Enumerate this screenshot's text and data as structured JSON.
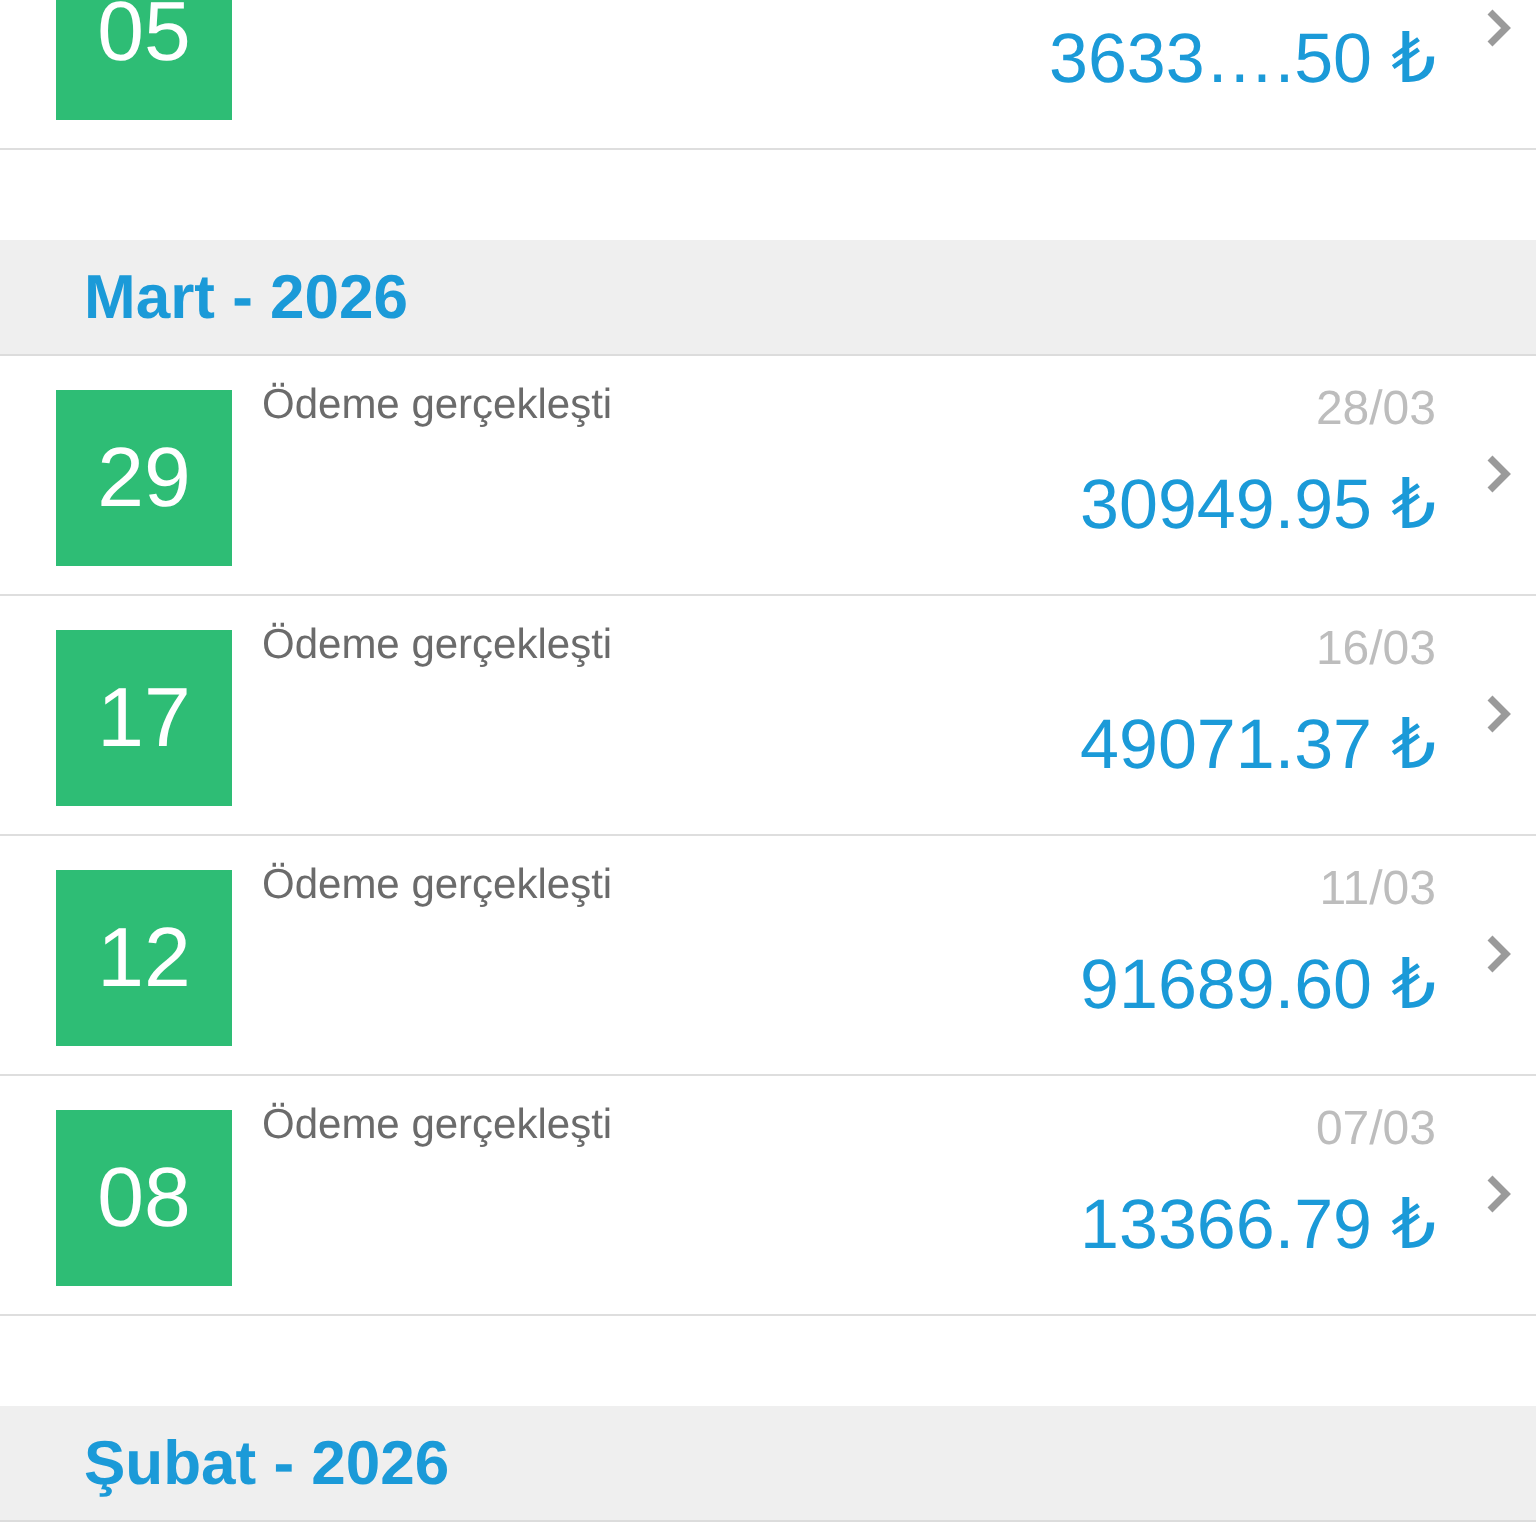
{
  "sections": [
    {
      "rows": [
        {
          "day": "05",
          "amount": "3633….50 ₺"
        }
      ]
    },
    {
      "title": "Mart - 2026",
      "rows": [
        {
          "day": "29",
          "status": "Ödeme gerçekleşti",
          "date": "28/03",
          "amount": "30949.95 ₺"
        },
        {
          "day": "17",
          "status": "Ödeme gerçekleşti",
          "date": "16/03",
          "amount": "49071.37 ₺"
        },
        {
          "day": "12",
          "status": "Ödeme gerçekleşti",
          "date": "11/03",
          "amount": "91689.60 ₺"
        },
        {
          "day": "08",
          "status": "Ödeme gerçekleşti",
          "date": "07/03",
          "amount": "13366.79 ₺"
        }
      ]
    },
    {
      "title": "Şubat - 2026"
    }
  ]
}
